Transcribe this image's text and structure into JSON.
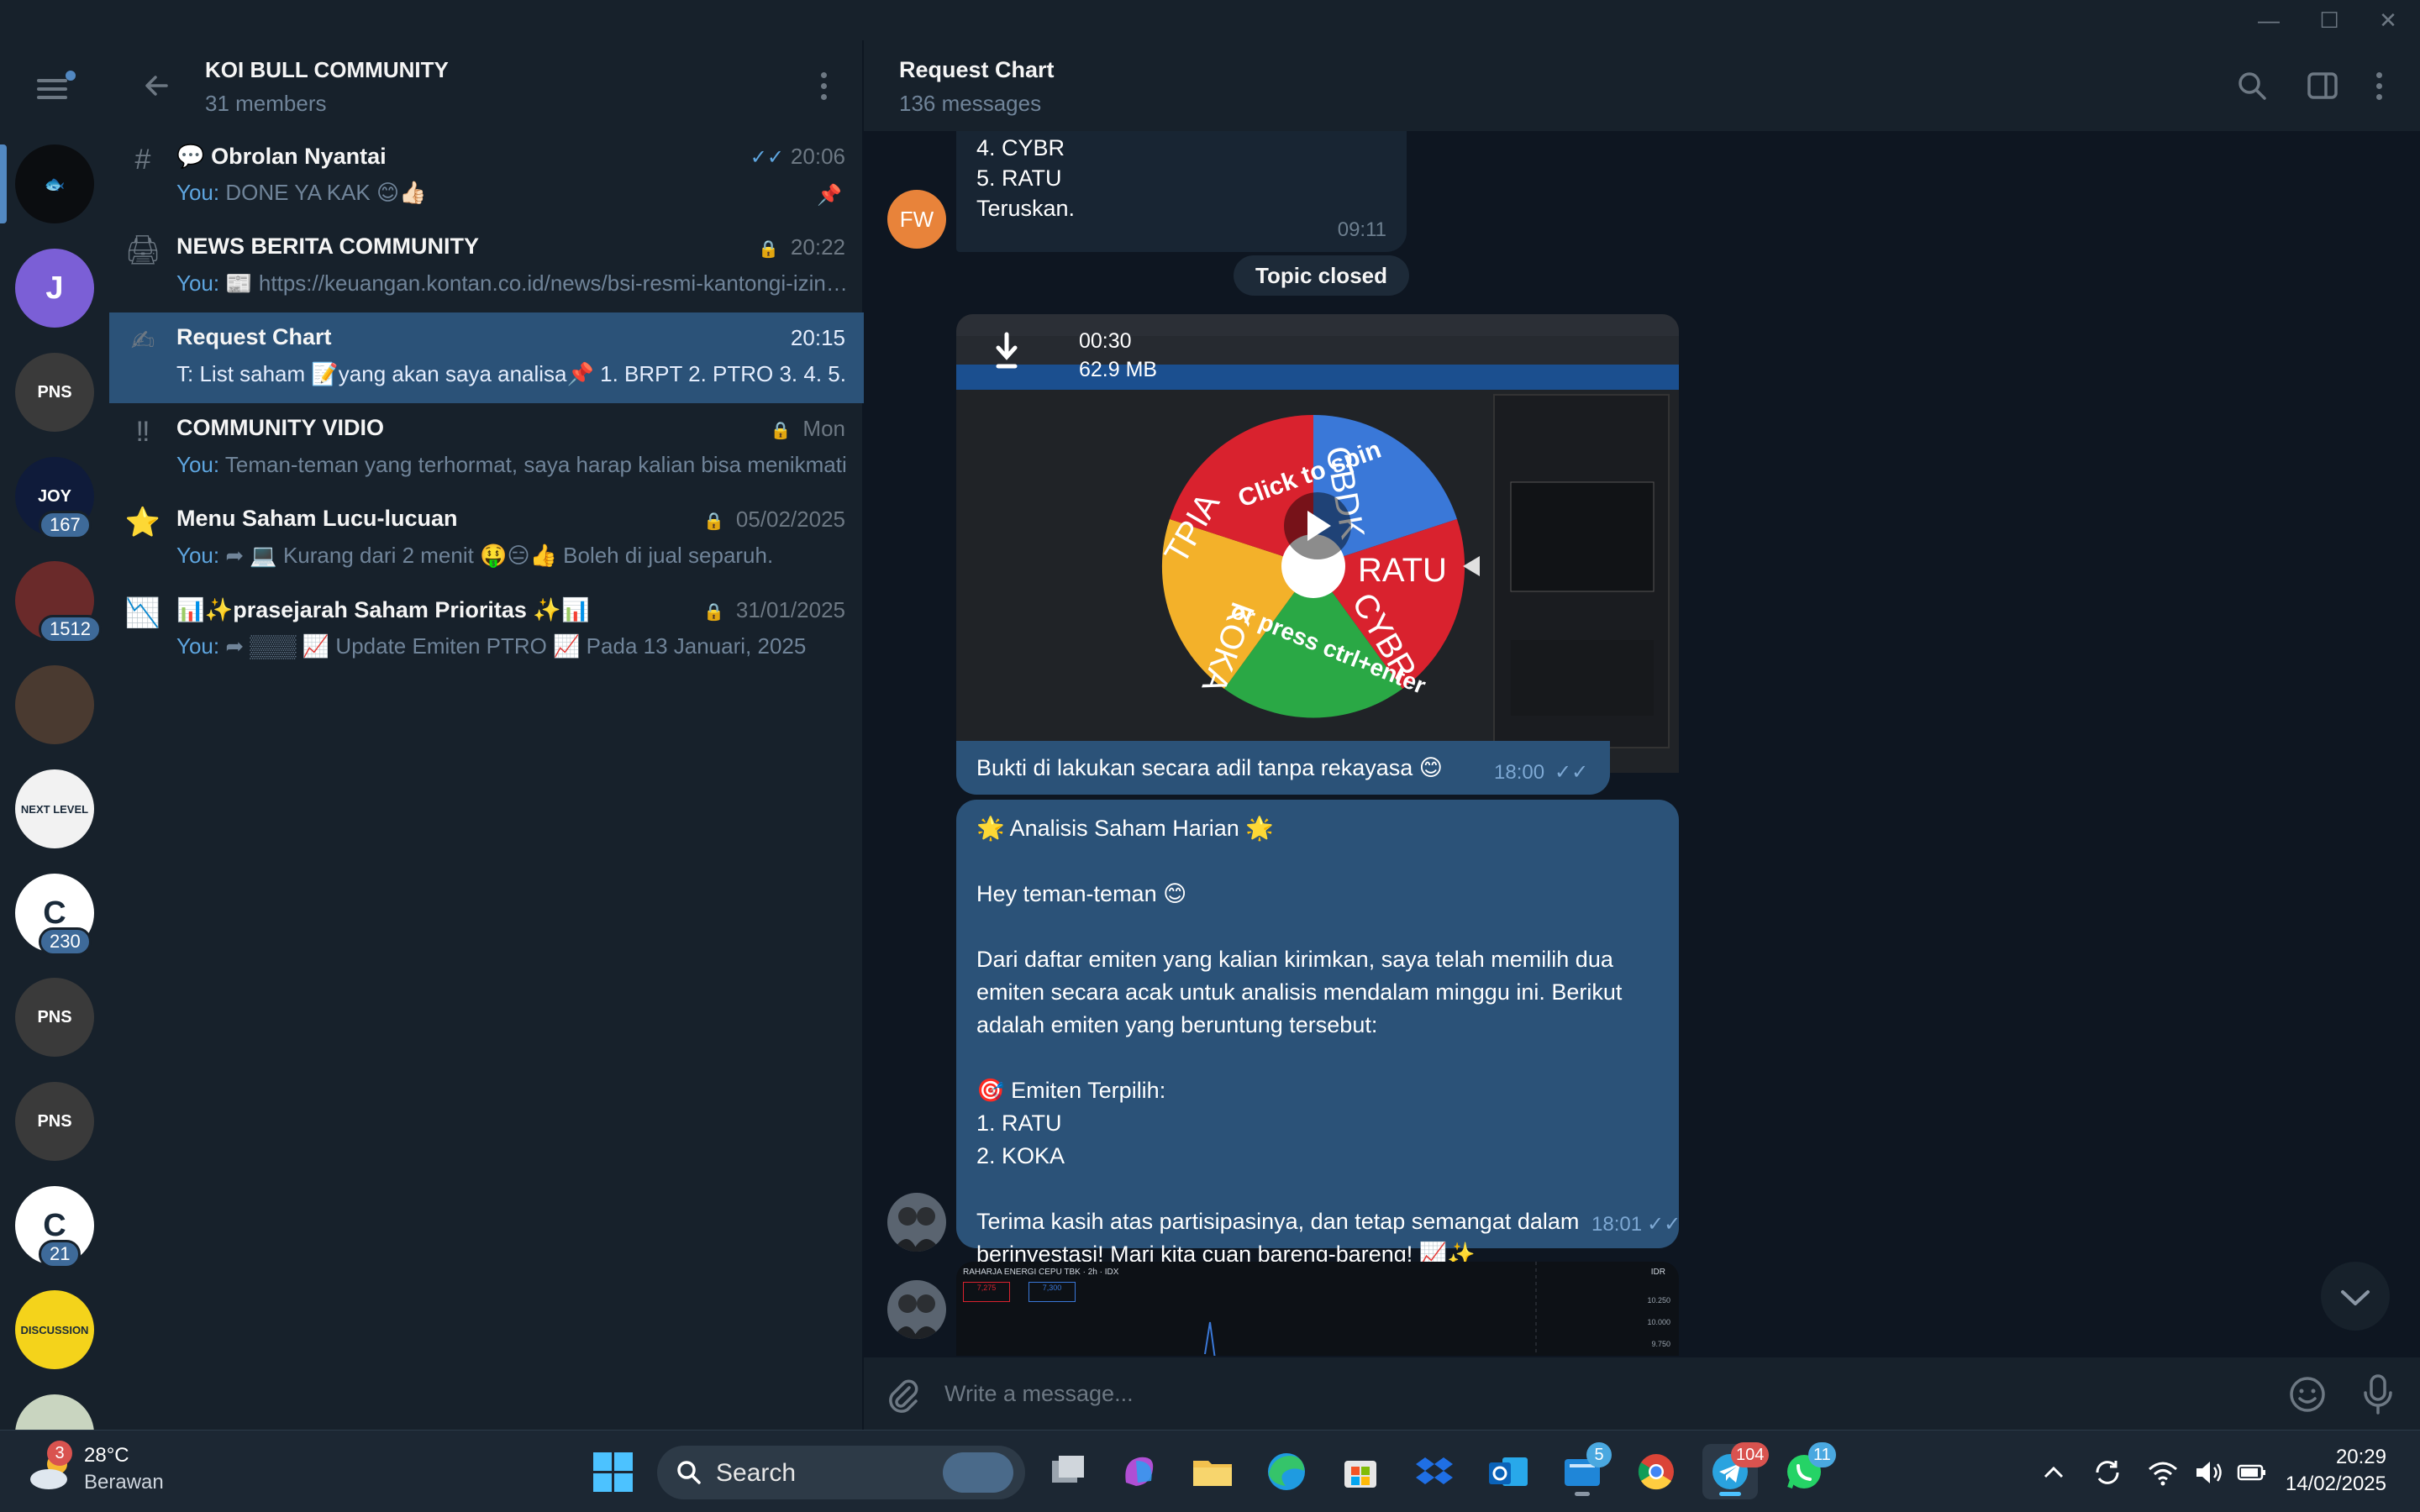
{
  "window": {
    "minimize": "—",
    "maximize": "☐",
    "close": "✕"
  },
  "group": {
    "title": "KOI BULL COMMUNITY",
    "members": "31 members"
  },
  "folders": [
    {
      "name": "folder-koi",
      "color": "#0b0d10",
      "glyph": "🐟"
    },
    {
      "name": "folder-j",
      "color": "#7b5fd6",
      "glyph": "J"
    },
    {
      "name": "folder-pns-1",
      "color": "#3a3a3a",
      "glyph": "PNS"
    },
    {
      "name": "folder-joy",
      "color": "#0f1b3a",
      "glyph": "JOY",
      "badge": "167"
    },
    {
      "name": "folder-meat",
      "color": "#6a2a2a",
      "glyph": "",
      "badge": "1512"
    },
    {
      "name": "folder-man",
      "color": "#4a3a30",
      "glyph": ""
    },
    {
      "name": "folder-next-level",
      "color": "#f2f2f2",
      "glyph": "NEXT LEVEL"
    },
    {
      "name": "folder-cuan-230",
      "color": "#ffffff",
      "glyph": "C",
      "badge": "230"
    },
    {
      "name": "folder-pns-2",
      "color": "#3a3a3a",
      "glyph": "PNS"
    },
    {
      "name": "folder-pns-3",
      "color": "#3a3a3a",
      "glyph": "PNS"
    },
    {
      "name": "folder-cuan-21",
      "color": "#ffffff",
      "glyph": "C",
      "badge": "21"
    },
    {
      "name": "folder-discussion",
      "color": "#f4d31b",
      "glyph": "DISCUSSION"
    },
    {
      "name": "folder-last",
      "color": "#c9d5c0",
      "glyph": ""
    }
  ],
  "topics": [
    {
      "icon": "#",
      "name": "💬 Obrolan Nyantai",
      "time": "20:06",
      "you": "You:",
      "preview": " DONE YA KAK 😊👍🏻",
      "ticks": "✓✓",
      "pinned": true,
      "locked": false
    },
    {
      "icon": "🖨",
      "name": "NEWS BERITA COMMUNITY",
      "time": "20:22",
      "you": "You:",
      "preview": " 📰 https://keuangan.kontan.co.id/news/bsi-resmi-kantongi-izin-bullion-bank",
      "locked": true
    },
    {
      "icon": "✍",
      "name": "Request Chart",
      "time": "20:15",
      "you": "T:",
      "preview": " List saham 📝yang akan saya analisa📌 1. BRPT 2. PTRO 3. 4. 5.",
      "locked": false,
      "active": true
    },
    {
      "icon": "‼",
      "name": "COMMUNITY VIDIO",
      "time": "Mon",
      "you": "You:",
      "preview": " Teman-teman yang terhormat, saya harap kalian bisa menikmati",
      "locked": true
    },
    {
      "icon": "⭐",
      "name": "Menu Saham Lucu-lucuan",
      "time": "05/02/2025",
      "you": "You:",
      "preview": " ➦ 💻 Kurang dari 2 menit 🤑😑👍 Boleh di jual separuh.",
      "locked": true
    },
    {
      "icon": "📉",
      "name": "📊✨prasejarah Saham Prioritas ✨📊",
      "time": "31/01/2025",
      "you": "You:",
      "preview": " ➦ ▒▒▒ 📈 Update Emiten PTRO 📈  Pada 13 Januari, 2025",
      "locked": true
    }
  ],
  "chat": {
    "title": "Request Chart",
    "subtitle": "136 messages",
    "msg1": {
      "avatar": "FW",
      "lines": [
        "4. CYBR",
        "5. RATU",
        "Teruskan."
      ],
      "time": "09:11"
    },
    "service": "Topic closed",
    "video": {
      "duration": "00:30",
      "size": "62.9 MB",
      "wheel": [
        "CBDK",
        "RATU",
        "CYBR",
        "KOKA",
        "TPIA"
      ],
      "caption_spin": "Click to spin",
      "caption_ctrl": "or press ctrl+enter"
    },
    "msg2": {
      "text": "Bukti di lakukan secara adil tanpa rekayasa 😊",
      "time": "18:00",
      "ticks": "✓✓"
    },
    "msg3": {
      "lines": [
        "🌟 Analisis Saham Harian 🌟",
        "",
        "Hey teman-teman 😊",
        "",
        "Dari daftar emiten yang kalian kirimkan, saya telah memilih dua",
        "emiten secara acak untuk analisis mendalam minggu ini. Berikut",
        "adalah emiten yang beruntung tersebut:",
        "",
        "🎯 Emiten Terpilih:",
        "1. RATU",
        "2. KOKA",
        "",
        "Terima kasih atas partisipasinya, dan tetap semangat dalam",
        "berinvestasi! Mari kita cuan bareng-bareng! 📈✨"
      ],
      "time": "18:01",
      "ticks": "✓✓"
    },
    "msg4": {
      "header": "RAHARJA ENERGI CEPU TBK · 2h · IDX",
      "price_a": "7,275",
      "price_b": "7,300",
      "right": "IDR",
      "y1": "10.250",
      "y2": "10.000",
      "y3": "9.750"
    },
    "composer_placeholder": "Write a message..."
  },
  "taskbar": {
    "weather": {
      "temp": "28°C",
      "cond": "Berawan",
      "badge": "3"
    },
    "search": "Search",
    "outlook_badge": "5",
    "telegram_badge": "104",
    "whatsapp_badge": "11",
    "time": "20:29",
    "date": "14/02/2025"
  },
  "colors": {
    "accent": "#5288c1",
    "bubble_out": "#2b5278",
    "bg": "#0e1621",
    "panel": "#17212b"
  }
}
